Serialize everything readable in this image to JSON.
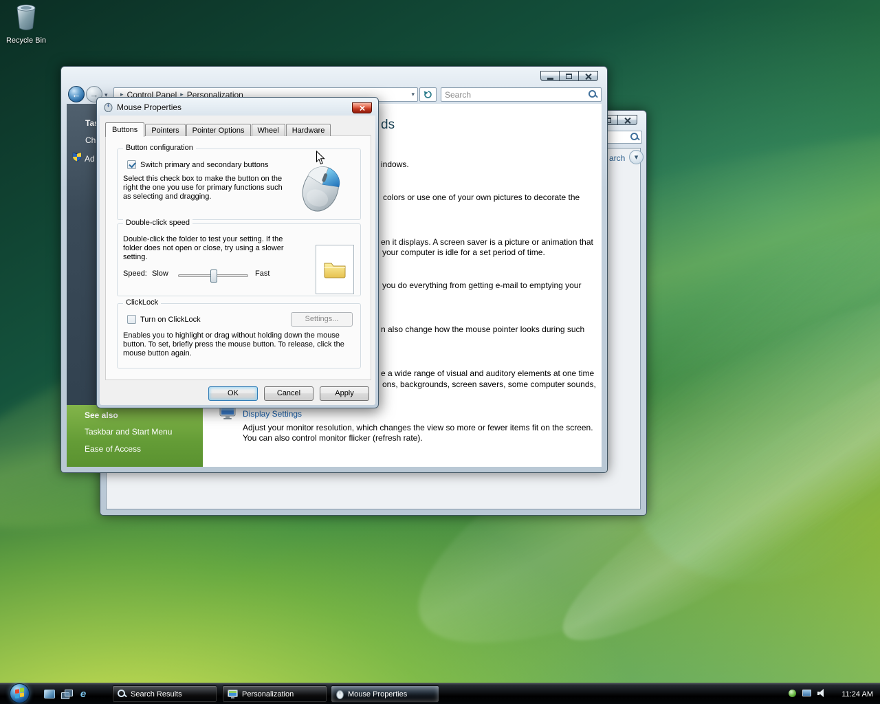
{
  "colors": {
    "aero_blue": "#2f7cc4",
    "link_blue": "#1860ad",
    "close_red": "#c33a22",
    "sidebar_green": "#649c36"
  },
  "glyphs": {
    "breadcrumb_arrow": "▸",
    "chevron_down": "▾",
    "back_arrow": "←",
    "forward_arrow": "→",
    "ie": "e"
  },
  "desktop": {
    "recycle_bin_label": "Recycle Bin"
  },
  "search_window": {
    "advanced_search_fragment": "arch"
  },
  "personalization_window": {
    "breadcrumb": [
      "Control Panel",
      "Personalization"
    ],
    "search_placeholder": "Search",
    "sidebar": {
      "tasks_fragment": "Tas",
      "item1_fragment": "Ch",
      "item2_fragment": "Ad",
      "see_also": "See also",
      "link1": "Taskbar and Start Menu",
      "link2": "Ease of Access"
    },
    "content": {
      "heading_fragment": "ds",
      "fragments": [
        "indows.",
        "colors or use one of your own pictures to decorate the",
        "en it displays. A screen saver is a picture or animation that",
        "your computer is idle for a set period of time.",
        "you do everything from getting e-mail to emptying your",
        "n also change how the mouse pointer looks during such",
        "e a wide range of visual and auditory elements at one time",
        "ons, backgrounds, screen savers, some computer sounds,"
      ],
      "display_settings_title": "Display Settings",
      "display_settings_desc_line1": "Adjust your monitor resolution, which changes the view so more or fewer items fit on the screen.",
      "display_settings_desc_line2": "You can also control monitor flicker (refresh rate)."
    }
  },
  "mouse_dialog": {
    "title": "Mouse Properties",
    "tabs": [
      "Buttons",
      "Pointers",
      "Pointer Options",
      "Wheel",
      "Hardware"
    ],
    "active_tab": "Buttons",
    "button_configuration": {
      "legend": "Button configuration",
      "switch_checkbox_label": "Switch primary and secondary buttons",
      "switch_checked": true,
      "description": "Select this check box to make the button on the right the one you use for primary functions such as selecting and dragging."
    },
    "double_click_speed": {
      "legend": "Double-click speed",
      "description": "Double-click the folder to test your setting. If the folder does not open or close, try using a slower setting.",
      "speed_label": "Speed:",
      "slow_label": "Slow",
      "fast_label": "Fast"
    },
    "clicklock": {
      "legend": "ClickLock",
      "checkbox_label": "Turn on ClickLock",
      "checked": false,
      "settings_button": "Settings...",
      "description": "Enables you to highlight or drag without holding down the mouse button. To set, briefly press the mouse button. To release, click the mouse button again."
    },
    "ok": "OK",
    "cancel": "Cancel",
    "apply": "Apply"
  },
  "taskbar": {
    "tasks": [
      "Search Results",
      "Personalization",
      "Mouse Properties"
    ],
    "active_task": "Mouse Properties",
    "clock": "11:24 AM"
  }
}
